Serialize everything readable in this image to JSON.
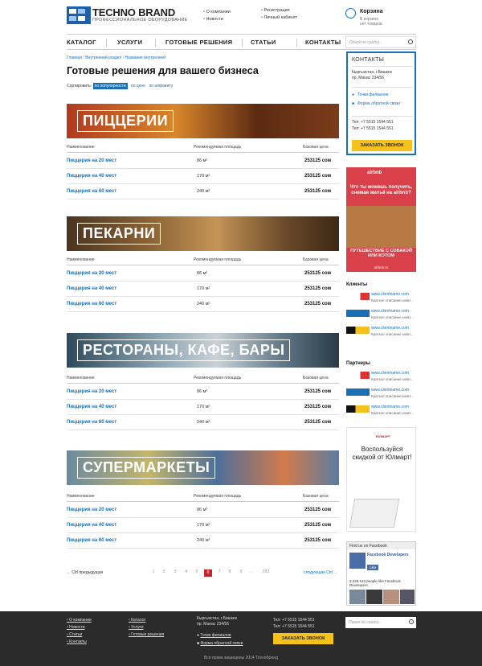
{
  "header": {
    "brand": "TECHNO BRAND",
    "tagline": "ПРОФЕССИОНАЛЬНОЕ ОБОРУДОВАНИЕ",
    "nav_col1": [
      "О компании",
      "Новости"
    ],
    "nav_col2": [
      "Регистрация",
      "Личный кабинет"
    ],
    "cart_title": "Корзина",
    "cart_sub1": "В корзине",
    "cart_sub2": "нет товаров"
  },
  "menu": {
    "items": [
      "КАТАЛОГ",
      "УСЛУГИ",
      "ГОТОВЫЕ РЕШЕНИЯ",
      "СТАТЬИ",
      "КОНТАКТЫ"
    ],
    "search_placeholder": "Поиск по сайту..."
  },
  "breadcrumb": {
    "items": [
      "Главная",
      "Внутренний раздел",
      "Название внутренней"
    ],
    "sep": "/"
  },
  "page_title": "Готовые решения для вашего бизнеса",
  "sort": {
    "label": "Сортировать:",
    "active": "по популярности",
    "opt2": "по цене",
    "opt3": "по алфавиту"
  },
  "table_headers": [
    "Наименование",
    "Рекомендуемая площадь",
    "Базовая цена"
  ],
  "sections": [
    {
      "title": "ПИЦЦЕРИИ",
      "rows": [
        {
          "name": "Пиццерия на 20 мест",
          "area": "86 м²",
          "price": "253125 сом"
        },
        {
          "name": "Пиццерия на 40 мест",
          "area": "170 м²",
          "price": "253125 сом"
        },
        {
          "name": "Пиццерия на 60 мест",
          "area": "240 м²",
          "price": "253125 сом"
        }
      ]
    },
    {
      "title": "ПЕКАРНИ",
      "rows": [
        {
          "name": "Пиццерия на 20 мест",
          "area": "86 м²",
          "price": "253125 сом"
        },
        {
          "name": "Пиццерия на 40 мест",
          "area": "170 м²",
          "price": "253125 сом"
        },
        {
          "name": "Пиццерия на 60 мест",
          "area": "240 м²",
          "price": "253125 сом"
        }
      ]
    },
    {
      "title": "РЕСТОРАНЫ, КАФЕ, БАРЫ",
      "rows": [
        {
          "name": "Пиццерия на 20 мест",
          "area": "86 м²",
          "price": "253125 сом"
        },
        {
          "name": "Пиццерия на 40 мест",
          "area": "170 м²",
          "price": "253125 сом"
        },
        {
          "name": "Пиццерия на 60 мест",
          "area": "240 м²",
          "price": "253125 сом"
        }
      ]
    },
    {
      "title": "СУПЕРМАРКЕТЫ",
      "rows": [
        {
          "name": "Пиццерия на 20 мест",
          "area": "86 м²",
          "price": "253125 сом"
        },
        {
          "name": "Пиццерия на 40 мест",
          "area": "170 м²",
          "price": "253125 сом"
        },
        {
          "name": "Пиццерия на 60 мест",
          "area": "240 м²",
          "price": "253125 сом"
        }
      ]
    }
  ],
  "pagination": {
    "prev": "← Ctrl предыдущая",
    "next": "следующая Ctrl →",
    "pages": [
      "1",
      "2",
      "3",
      "4",
      "5",
      "6",
      "7",
      "8",
      "9",
      "...",
      "283"
    ],
    "current": "6"
  },
  "sidebar": {
    "contacts_title": "КОНТАКТЫ",
    "address1": "Кыргызстан, г.Бишкек",
    "address2": "пр. Манас 234/56",
    "link1": "Точки филиалов",
    "link2": "Форма обратной связи",
    "tel1": "Тел: +7 5515 1544 551",
    "tel2": "Тел: +7 5515 1544 551",
    "order_button": "ЗАКАЗАТЬ ЗВОНОК",
    "ad_airbnb_logo": "airbnb",
    "ad_airbnb_text": "Что ты можешь получить, снимая жильё на airbnb?",
    "ad_airbnb_text2": "ПУТЕШЕСТВИЕ С СОБАКОЙ ИЛИ КОТОМ",
    "ad_airbnb_url": "airbnb.ru",
    "clients_title": "Клиенты",
    "partners_title": "Партнеры",
    "client_url": "www.clientname.com",
    "client_desc": "Краткое описание комп...",
    "ad_ulmart_logo": "ЮЛМАРТ",
    "ad_ulmart_text": "Воспользуйся скидкой от Юлмарт!",
    "fb_header": "Find us on Facebook",
    "fb_page": "Facebook Developers",
    "fb_like": "Like",
    "fb_likes_text": "3,229,513 people like Facebook Developers."
  },
  "footer": {
    "col1": [
      "О компании",
      "Новости",
      "Статьи",
      "Контакты"
    ],
    "col2": [
      "Каталог",
      "Услуги",
      "Готовые решения"
    ],
    "address1": "Кыргызстан, г.Бишкек",
    "address2": "пр. Манас 234/56",
    "link1": "Точки филиалов",
    "link2": "Форма обратной связи",
    "tel1": "Тел: +7 5515 1544 551",
    "tel2": "Тел: +7 5515 1544 551",
    "order_button": "ЗАКАЗАТЬ ЗВОНОК",
    "search_placeholder": "Поиск по сайту...",
    "copyright": "Все права защищены 2014 ТехноБренд"
  },
  "colors": {
    "accent": "#1a6fb5",
    "yellow": "#f5c21d",
    "red": "#c0272d",
    "footer": "#2b2b2b"
  }
}
